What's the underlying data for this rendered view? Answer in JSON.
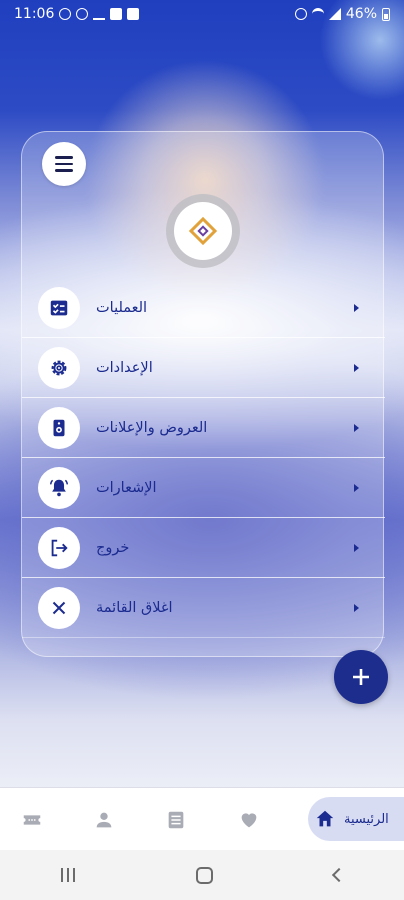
{
  "status_bar": {
    "time": "11:06",
    "battery": "46%"
  },
  "menu": {
    "items": [
      {
        "label": "العمليات",
        "icon": "operations-icon"
      },
      {
        "label": "الإعدادات",
        "icon": "gear-icon"
      },
      {
        "label": "العروض والإعلانات",
        "icon": "speaker-icon"
      },
      {
        "label": "الإشعارات",
        "icon": "bell-icon"
      },
      {
        "label": "خروج",
        "icon": "logout-icon"
      },
      {
        "label": "اغلاق القائمة",
        "icon": "close-icon"
      }
    ]
  },
  "bottom_nav": {
    "active_label": "الرئيسية",
    "tabs": [
      "home-icon",
      "heart-icon",
      "list-icon",
      "person-icon",
      "ticket-icon"
    ]
  },
  "colors": {
    "accent": "#1d2d8d",
    "active_tab_bg": "#d8dcf3"
  }
}
